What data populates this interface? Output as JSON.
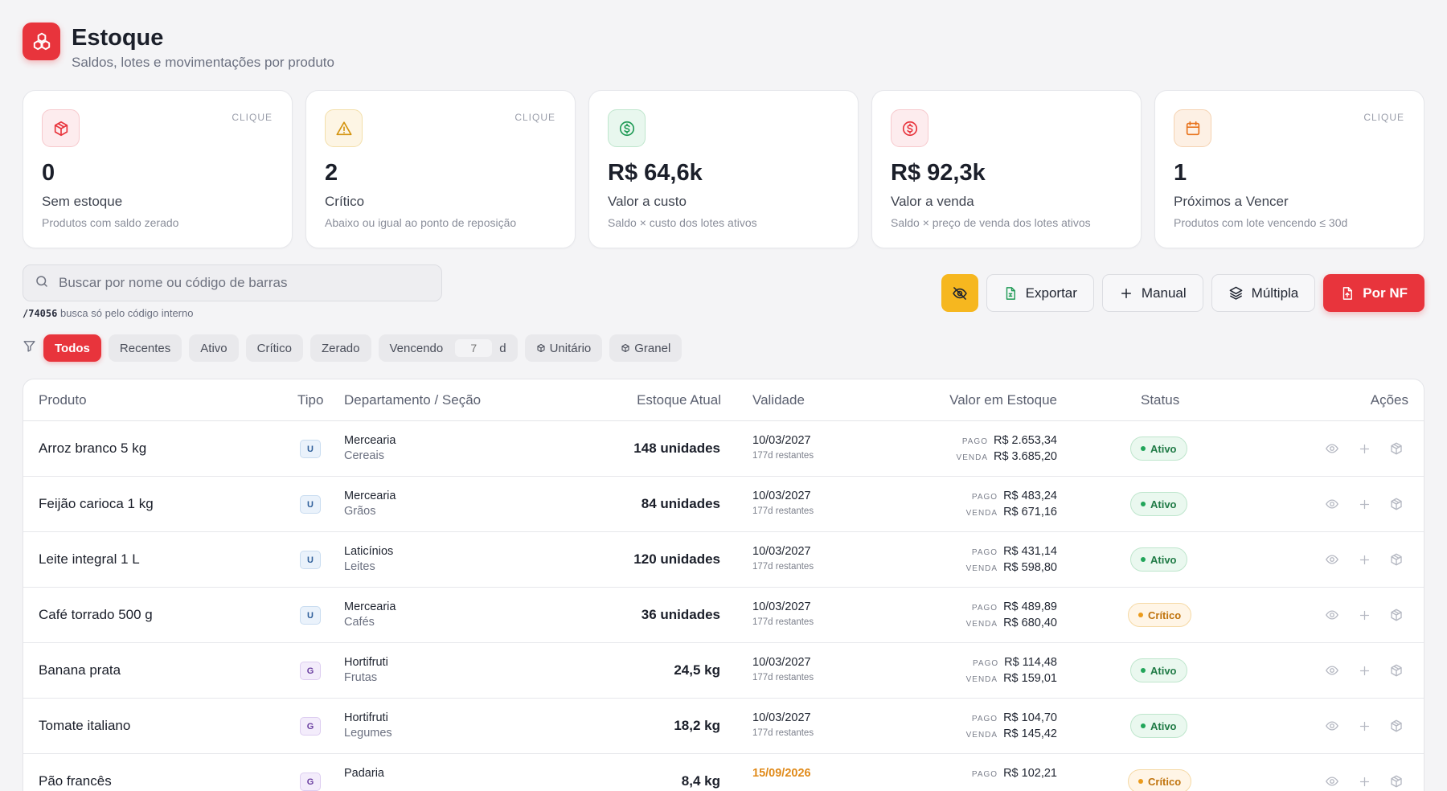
{
  "header": {
    "title": "Estoque",
    "subtitle": "Saldos, lotes e movimentações por produto"
  },
  "cards": [
    {
      "value": "0",
      "label": "Sem estoque",
      "desc": "Produtos com saldo zerado",
      "clique": "CLIQUE",
      "icon": "box-icon",
      "color": "#e8343c"
    },
    {
      "value": "2",
      "label": "Crítico",
      "desc": "Abaixo ou igual ao ponto de reposição",
      "clique": "CLIQUE",
      "icon": "warning-icon",
      "color": "#e0a020"
    },
    {
      "value": "R$ 64,6k",
      "label": "Valor a custo",
      "desc": "Saldo × custo dos lotes ativos",
      "clique": "",
      "icon": "dollar-icon",
      "color": "#22a55a"
    },
    {
      "value": "R$ 92,3k",
      "label": "Valor a venda",
      "desc": "Saldo × preço de venda dos lotes ativos",
      "clique": "",
      "icon": "dollar-icon",
      "color": "#e8343c"
    },
    {
      "value": "1",
      "label": "Próximos a Vencer",
      "desc": "Produtos com lote vencendo ≤ 30d",
      "clique": "CLIQUE",
      "icon": "calendar-icon",
      "color": "#eb7a1c"
    }
  ],
  "search": {
    "placeholder": "Buscar por nome ou código de barras",
    "hint_code": "/74056",
    "hint_text": " busca só pelo código interno"
  },
  "actions": {
    "export": "Exportar",
    "manual": "Manual",
    "multipla": "Múltipla",
    "nf": "Por NF"
  },
  "filters": {
    "todos": "Todos",
    "recentes": "Recentes",
    "ativo": "Ativo",
    "critico": "Crítico",
    "zerado": "Zerado",
    "vencendo": "Vencendo",
    "days": "7",
    "days_unit": "d",
    "unitario": "Unitário",
    "granel": "Granel"
  },
  "columns": {
    "produto": "Produto",
    "tipo": "Tipo",
    "depto": "Departamento / Seção",
    "estoque": "Estoque Atual",
    "validade": "Validade",
    "valor": "Valor em Estoque",
    "status": "Status",
    "acoes": "Ações"
  },
  "labels": {
    "pago": "PAGO",
    "venda": "VENDA"
  },
  "rows": [
    {
      "name": "Arroz branco 5 kg",
      "tipo": "U",
      "dept": "Mercearia",
      "sec": "Cereais",
      "estoque": "148 unidades",
      "validade": "10/03/2027",
      "restantes": "177d restantes",
      "pago": "R$ 2.653,34",
      "venda": "R$ 3.685,20",
      "status": "Ativo",
      "statusType": "ativo"
    },
    {
      "name": "Feijão carioca 1 kg",
      "tipo": "U",
      "dept": "Mercearia",
      "sec": "Grãos",
      "estoque": "84 unidades",
      "validade": "10/03/2027",
      "restantes": "177d restantes",
      "pago": "R$ 483,24",
      "venda": "R$ 671,16",
      "status": "Ativo",
      "statusType": "ativo"
    },
    {
      "name": "Leite integral 1 L",
      "tipo": "U",
      "dept": "Laticínios",
      "sec": "Leites",
      "estoque": "120 unidades",
      "validade": "10/03/2027",
      "restantes": "177d restantes",
      "pago": "R$ 431,14",
      "venda": "R$ 598,80",
      "status": "Ativo",
      "statusType": "ativo"
    },
    {
      "name": "Café torrado 500 g",
      "tipo": "U",
      "dept": "Mercearia",
      "sec": "Cafés",
      "estoque": "36 unidades",
      "validade": "10/03/2027",
      "restantes": "177d restantes",
      "pago": "R$ 489,89",
      "venda": "R$ 680,40",
      "status": "Crítico",
      "statusType": "critico"
    },
    {
      "name": "Banana prata",
      "tipo": "G",
      "dept": "Hortifruti",
      "sec": "Frutas",
      "estoque": "24,5 kg",
      "validade": "10/03/2027",
      "restantes": "177d restantes",
      "pago": "R$ 114,48",
      "venda": "R$ 159,01",
      "status": "Ativo",
      "statusType": "ativo"
    },
    {
      "name": "Tomate italiano",
      "tipo": "G",
      "dept": "Hortifruti",
      "sec": "Legumes",
      "estoque": "18,2 kg",
      "validade": "10/03/2027",
      "restantes": "177d restantes",
      "pago": "R$ 104,70",
      "venda": "R$ 145,42",
      "status": "Ativo",
      "statusType": "ativo"
    },
    {
      "name": "Pão francês",
      "tipo": "G",
      "dept": "Padaria",
      "sec": "",
      "estoque": "8,4 kg",
      "validade": "15/09/2026",
      "restantes": "",
      "pago": "R$ 102,21",
      "venda": "",
      "status": "Crítico",
      "statusType": "critico",
      "warn": true
    }
  ]
}
